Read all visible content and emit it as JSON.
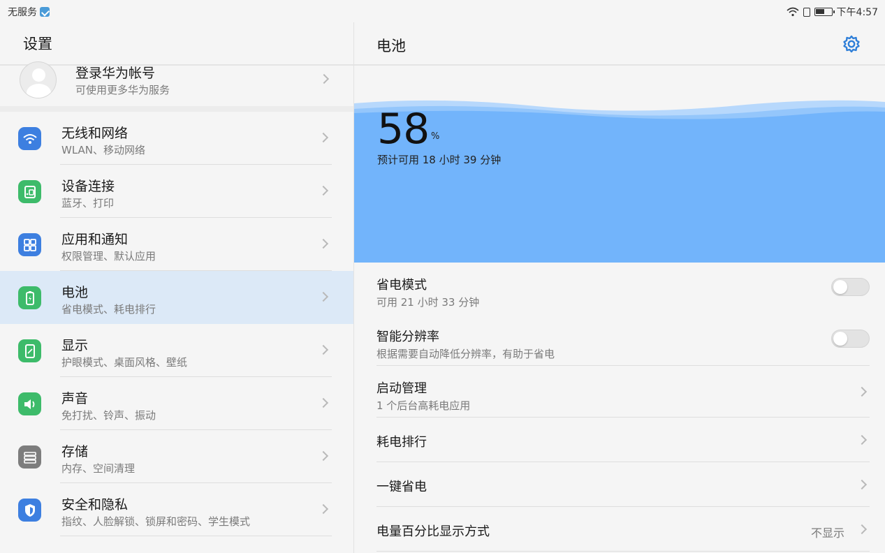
{
  "status_bar": {
    "carrier": "无服务",
    "time": "下午4:57"
  },
  "left": {
    "title": "设置",
    "account": {
      "title": "登录华为帐号",
      "subtitle": "可使用更多华为服务"
    },
    "items": [
      {
        "title": "无线和网络",
        "subtitle": "WLAN、移动网络",
        "icon": "wifi-icon",
        "color": "#3d7fe0"
      },
      {
        "title": "设备连接",
        "subtitle": "蓝牙、打印",
        "icon": "device-connection-icon",
        "color": "#3dbb6a"
      },
      {
        "title": "应用和通知",
        "subtitle": "权限管理、默认应用",
        "icon": "apps-icon",
        "color": "#3d7fe0"
      },
      {
        "title": "电池",
        "subtitle": "省电模式、耗电排行",
        "icon": "battery-icon",
        "color": "#3dbb6a",
        "selected": true
      },
      {
        "title": "显示",
        "subtitle": "护眼模式、桌面风格、壁纸",
        "icon": "display-icon",
        "color": "#3dbb6a"
      },
      {
        "title": "声音",
        "subtitle": "免打扰、铃声、振动",
        "icon": "sound-icon",
        "color": "#3dbb6a"
      },
      {
        "title": "存储",
        "subtitle": "内存、空间清理",
        "icon": "storage-icon",
        "color": "#7d7d7d"
      },
      {
        "title": "安全和隐私",
        "subtitle": "指纹、人脸解锁、锁屏和密码、学生模式",
        "icon": "shield-icon",
        "color": "#3d7fe0"
      }
    ]
  },
  "right": {
    "title": "电池",
    "battery": {
      "percent": "58",
      "percent_sign": "%",
      "estimate": "预计可用 18 小时 39 分钟"
    },
    "rows": [
      {
        "title": "省电模式",
        "subtitle": "可用 21 小时 33 分钟",
        "control": "toggle",
        "on": false
      },
      {
        "title": "智能分辨率",
        "subtitle": "根据需要自动降低分辨率，有助于省电",
        "control": "toggle",
        "on": false
      },
      {
        "title": "启动管理",
        "subtitle": "1 个后台高耗电应用",
        "control": "chevron"
      },
      {
        "title": "耗电排行",
        "control": "chevron"
      },
      {
        "title": "一键省电",
        "control": "chevron"
      },
      {
        "title": "电量百分比显示方式",
        "value": "不显示",
        "control": "chevron"
      }
    ]
  }
}
